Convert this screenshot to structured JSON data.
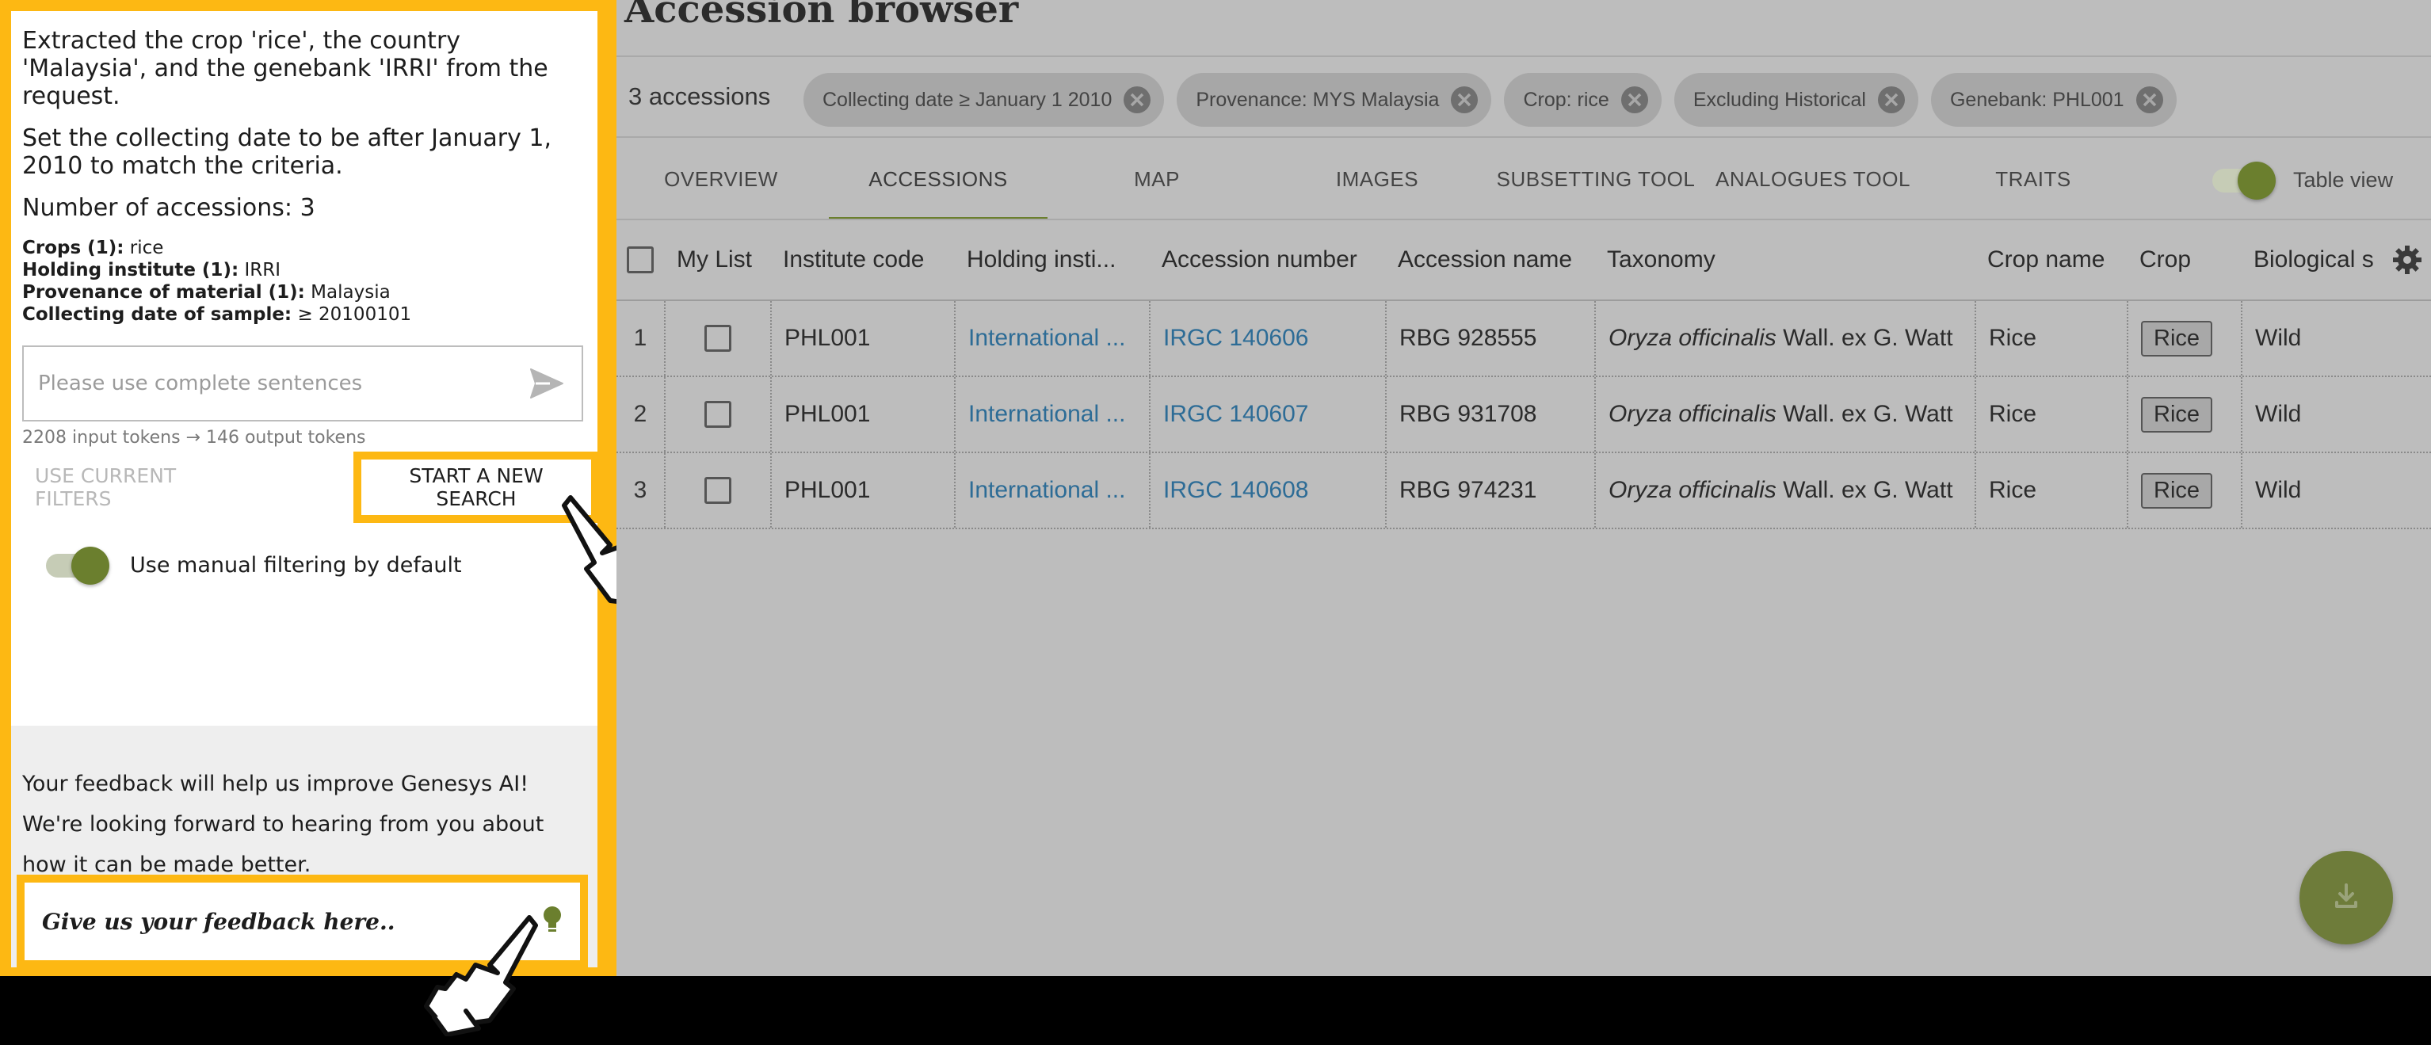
{
  "assistant": {
    "message_1": "Extracted the crop 'rice', the country 'Malaysia', and the genebank 'IRRI' from the request.",
    "message_2": "Set the collecting date to be after January 1, 2010 to match the criteria.",
    "accession_count": "Number of accessions: 3",
    "summary": [
      {
        "label": "Crops (1):",
        "value": " rice"
      },
      {
        "label": "Holding institute (1):",
        "value": " IRRI"
      },
      {
        "label": "Provenance of material (1):",
        "value": " Malaysia"
      },
      {
        "label": "Collecting date of sample:",
        "value": " ≥ 20100101"
      }
    ],
    "input_placeholder": "Please use complete sentences",
    "token_info": "2208 input tokens → 146 output tokens",
    "use_current_filters_label": "USE CURRENT FILTERS",
    "start_new_search_label": "START A NEW SEARCH",
    "manual_filter_label": "Use manual filtering by default",
    "manual_filter_on": true,
    "feedback_text": "Your feedback will help us improve Genesys AI! We're looking forward to hearing from you about how it can be made better.",
    "feedback_button_label": "Give us your feedback here.."
  },
  "browser": {
    "title": "Accession browser",
    "accession_count": "3 accessions",
    "filters": [
      "Collecting date ≥ January 1 2010",
      "Provenance: MYS  Malaysia",
      "Crop: rice",
      "Excluding Historical",
      "Genebank: PHL001"
    ],
    "tabs": [
      "OVERVIEW",
      "ACCESSIONS",
      "MAP",
      "IMAGES",
      "SUBSETTING TOOL",
      "ANALOGUES TOOL",
      "TRAITS"
    ],
    "active_tab": "ACCESSIONS",
    "table_view_label": "Table view",
    "table_view_on": true,
    "columns": [
      "My List",
      "Institute code",
      "Holding insti...",
      "Accession number",
      "Accession name",
      "Taxonomy",
      "Crop name",
      "Crop",
      "Biological s"
    ],
    "rows": [
      {
        "index": "1",
        "institute_code": "PHL001",
        "holding": "International ...",
        "acc_number": "IRGC 140606",
        "acc_name": "RBG 928555",
        "tax_genus": "Oryza officinalis",
        "tax_author": " Wall. ex G. Watt",
        "crop_name": "Rice",
        "crop": "Rice",
        "bio_status": "Wild"
      },
      {
        "index": "2",
        "institute_code": "PHL001",
        "holding": "International ...",
        "acc_number": "IRGC 140607",
        "acc_name": "RBG 931708",
        "tax_genus": "Oryza officinalis",
        "tax_author": " Wall. ex G. Watt",
        "crop_name": "Rice",
        "crop": "Rice",
        "bio_status": "Wild"
      },
      {
        "index": "3",
        "institute_code": "PHL001",
        "holding": "International ...",
        "acc_number": "IRGC 140608",
        "acc_name": "RBG 974231",
        "tax_genus": "Oryza officinalis",
        "tax_author": " Wall. ex G. Watt",
        "crop_name": "Rice",
        "crop": "Rice",
        "bio_status": "Wild"
      }
    ]
  },
  "colors": {
    "highlight": "#fdb813",
    "accent": "#6b7f2e",
    "link": "#2d6c96"
  },
  "icons": [
    "send-icon",
    "chip-close-icon",
    "gear-icon",
    "download-icon",
    "lightbulb-icon",
    "pointer-hand-icon"
  ]
}
